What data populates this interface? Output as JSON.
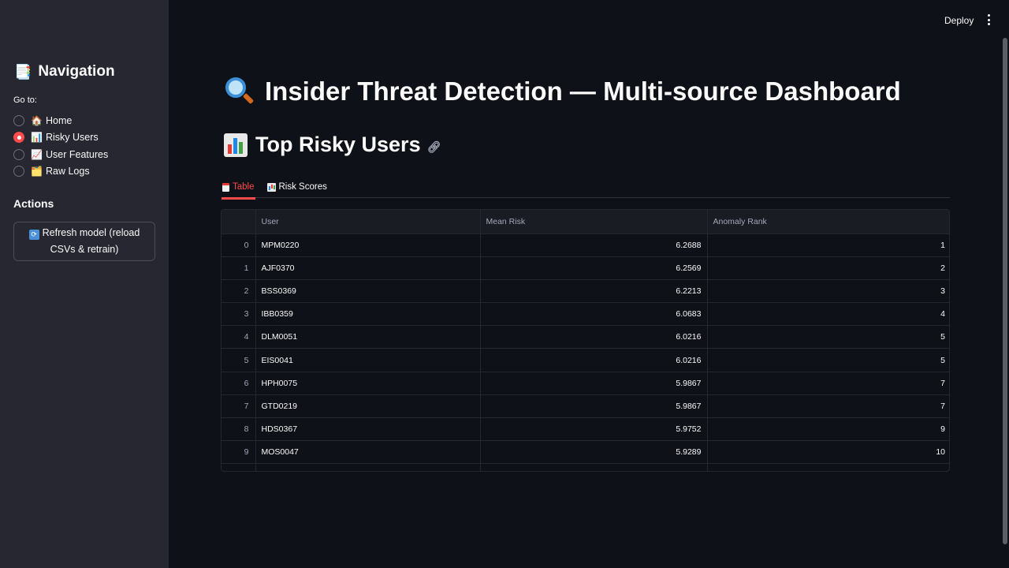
{
  "sidebar": {
    "nav_title": "Navigation",
    "nav_title_icon": "document-icon",
    "goto_label": "Go to:",
    "items": [
      {
        "emoji": "🏠",
        "label": "Home",
        "selected": false
      },
      {
        "emoji": "📊",
        "label": "Risky Users",
        "selected": true
      },
      {
        "emoji": "📈",
        "label": "User Features",
        "selected": false
      },
      {
        "emoji": "🗂️",
        "label": "Raw Logs",
        "selected": false
      }
    ],
    "actions_title": "Actions",
    "refresh_button": "Refresh model (reload CSVs & retrain)"
  },
  "header": {
    "deploy_label": "Deploy",
    "menu_icon": "kebab-menu-icon"
  },
  "main": {
    "title": "Insider Threat Detection — Multi-source Dashboard",
    "title_icon": "magnifier-icon",
    "section_title": "Top Risky Users",
    "section_icon": "bar-chart-icon",
    "tabs": [
      {
        "label": "Table",
        "active": true,
        "icon": "document-icon"
      },
      {
        "label": "Risk Scores",
        "active": false,
        "icon": "bar-chart-icon"
      }
    ],
    "table": {
      "columns": [
        "User",
        "Mean Risk",
        "Anomaly Rank"
      ],
      "rows": [
        {
          "index": "0",
          "user": "MPM0220",
          "mean_risk": "6.2688",
          "rank": "1"
        },
        {
          "index": "1",
          "user": "AJF0370",
          "mean_risk": "6.2569",
          "rank": "2"
        },
        {
          "index": "2",
          "user": "BSS0369",
          "mean_risk": "6.2213",
          "rank": "3"
        },
        {
          "index": "3",
          "user": "IBB0359",
          "mean_risk": "6.0683",
          "rank": "4"
        },
        {
          "index": "4",
          "user": "DLM0051",
          "mean_risk": "6.0216",
          "rank": "5"
        },
        {
          "index": "5",
          "user": "EIS0041",
          "mean_risk": "6.0216",
          "rank": "5"
        },
        {
          "index": "6",
          "user": "HPH0075",
          "mean_risk": "5.9867",
          "rank": "7"
        },
        {
          "index": "7",
          "user": "GTD0219",
          "mean_risk": "5.9867",
          "rank": "7"
        },
        {
          "index": "8",
          "user": "HDS0367",
          "mean_risk": "5.9752",
          "rank": "9"
        },
        {
          "index": "9",
          "user": "MOS0047",
          "mean_risk": "5.9289",
          "rank": "10"
        }
      ]
    }
  },
  "colors": {
    "background": "#0e1117",
    "sidebar": "#262730",
    "accent": "#ff4b4b",
    "text": "#fafafa",
    "muted": "#a3a8b8"
  }
}
